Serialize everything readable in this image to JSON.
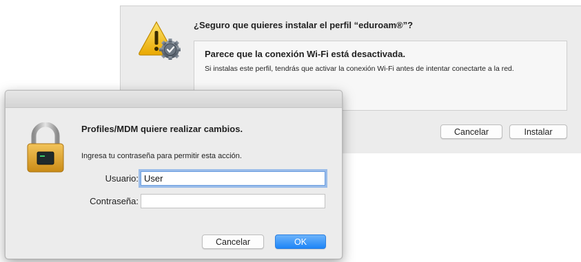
{
  "install_sheet": {
    "title": "¿Seguro que quieres instalar el perfil “eduroam®”?",
    "info_heading": "Parece que la conexión Wi-Fi está desactivada.",
    "info_body": "Si instalas este perfil, tendrás que activar la conexión Wi-Fi antes de intentar conectarte a la red.",
    "cancel_label": "Cancelar",
    "install_label": "Instalar",
    "icon": "warning-gear-icon"
  },
  "auth_dialog": {
    "title": "Profiles/MDM quiere realizar cambios.",
    "description": "Ingresa tu contraseña para permitir esta acción.",
    "username_label": "Usuario:",
    "username_value": "User",
    "password_label": "Contraseña:",
    "password_value": "",
    "cancel_label": "Cancelar",
    "ok_label": "OK",
    "icon": "padlock-icon"
  },
  "colors": {
    "window_bg": "#ececec",
    "accent_blue": "#1e85f7",
    "focus_ring": "#5895e8",
    "warning_yellow": "#f5c518"
  }
}
